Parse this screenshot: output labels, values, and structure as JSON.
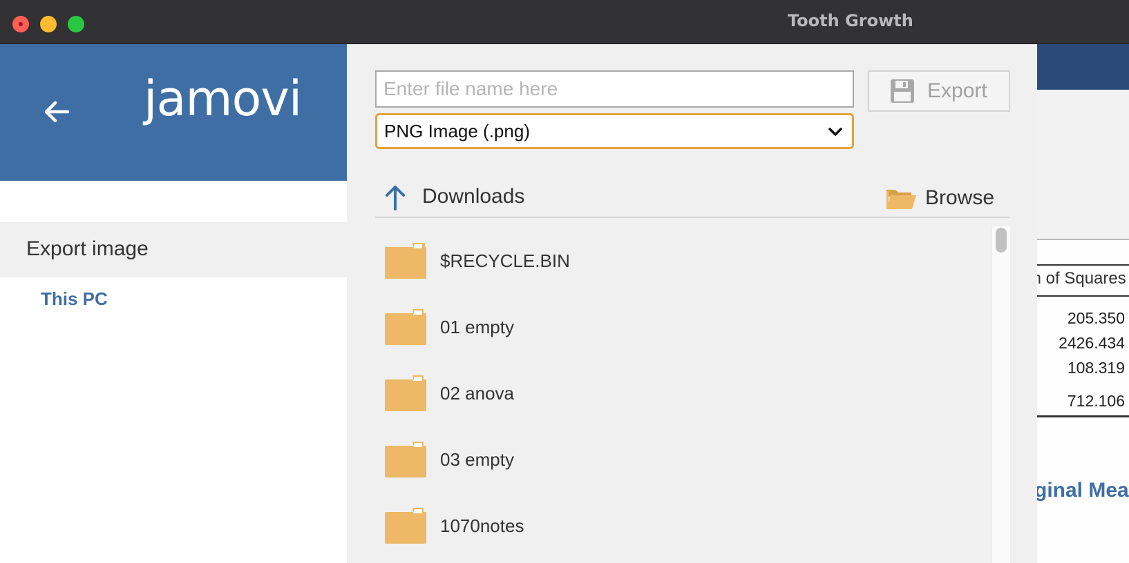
{
  "window": {
    "title": "Tooth Growth"
  },
  "sidebar": {
    "logo": "jamovi",
    "section_label": "Export image",
    "location_label": "This PC"
  },
  "export": {
    "filename_placeholder": "Enter file name here",
    "filename_value": "",
    "button_label": "Export",
    "format_selected": "PNG Image (.png)"
  },
  "browser": {
    "current_folder": "Downloads",
    "browse_label": "Browse",
    "items": [
      {
        "name": "$RECYCLE.BIN"
      },
      {
        "name": "01 empty"
      },
      {
        "name": "02 anova"
      },
      {
        "name": "03 empty"
      },
      {
        "name": "1070notes"
      }
    ]
  },
  "background": {
    "column_header": "m of Squares",
    "values": [
      "205.350",
      "2426.434",
      "108.319",
      "712.106"
    ],
    "subtitle": "ginal Mea"
  },
  "colors": {
    "brand_blue": "#3f6ea5",
    "titlebar": "#323133",
    "folder": "#edb966",
    "focus_outline": "#e4a23a"
  },
  "icons": {
    "back": "arrow-left-icon",
    "save": "floppy-disk-icon",
    "up": "arrow-up-icon",
    "browse": "folder-open-icon",
    "folder": "folder-icon",
    "dropdown": "chevron-down-icon"
  }
}
